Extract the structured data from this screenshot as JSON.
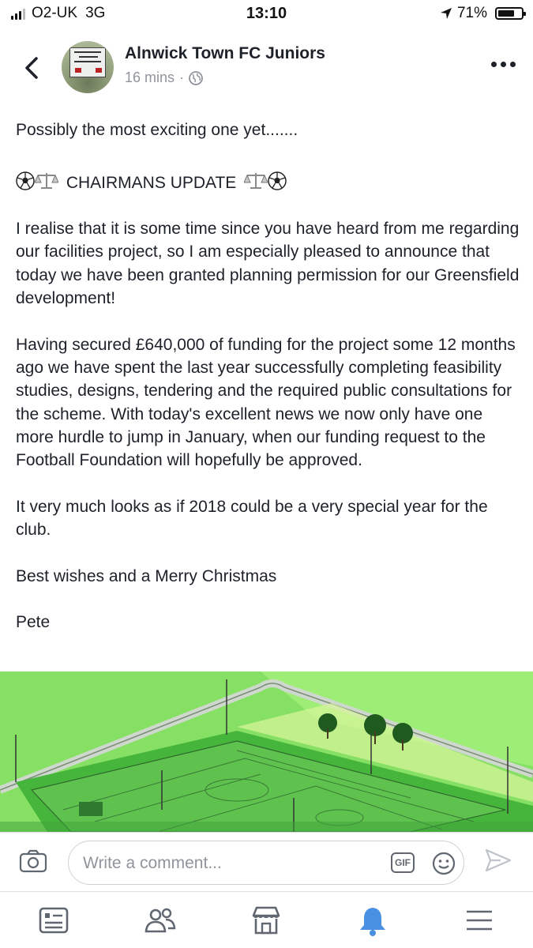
{
  "status": {
    "carrier": "O2-UK",
    "network": "3G",
    "time": "13:10",
    "battery": "71%",
    "battery_level": 0.71
  },
  "header": {
    "page_name": "Alnwick Town FC Juniors",
    "time_ago": "16 mins",
    "separator": "·",
    "avatar_icon": "club-sign-avatar"
  },
  "post": {
    "line1": "Possibly the most exciting one yet.......",
    "heading": "CHAIRMANS UPDATE",
    "para1": "I realise that it is some time since you have heard from me regarding our facilities project, so I am especially pleased to announce that today we have been granted planning permission for our Greensfield development!",
    "para2": "Having secured £640,000 of funding for the project some 12 months ago we have spent the last year successfully completing feasibility studies, designs, tendering and the required public consultations for the scheme. With today's excellent news we now only have one more hurdle to jump in January, when our funding request to the Football Foundation will hopefully be approved.",
    "para3": "It very much looks as if 2018 could be a very special year for the club.",
    "para4": "Best wishes and a Merry Christmas",
    "signature": "Pete",
    "emoji_pair": "⚽⚖"
  },
  "comment": {
    "placeholder": "Write a comment...",
    "gif_label": "GIF"
  },
  "colors": {
    "accent_blue": "#4a90e2",
    "text": "#1d2129",
    "muted": "#90949c",
    "grass": "#7edb5a"
  },
  "tabs": [
    "news-feed-icon",
    "friends-icon",
    "marketplace-icon",
    "notifications-icon",
    "menu-icon"
  ]
}
